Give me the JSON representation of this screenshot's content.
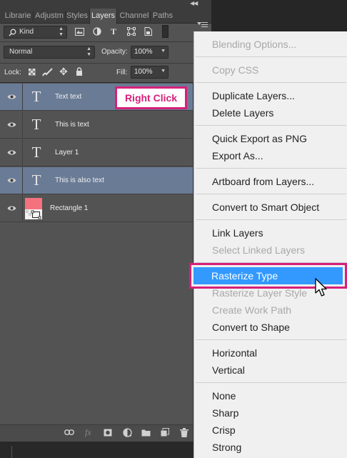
{
  "tabs": [
    {
      "label": "Librarie",
      "active": false
    },
    {
      "label": "Adjustm",
      "active": false
    },
    {
      "label": "Styles",
      "active": false
    },
    {
      "label": "Layers",
      "active": true
    },
    {
      "label": "Channel",
      "active": false
    },
    {
      "label": "Paths",
      "active": false
    }
  ],
  "filter": {
    "label": "Kind"
  },
  "blend": {
    "mode": "Normal",
    "opacity_label": "Opacity:",
    "opacity": "100%"
  },
  "lock": {
    "label": "Lock:",
    "fill_label": "Fill:",
    "fill": "100%"
  },
  "layers": [
    {
      "name": "Text text",
      "kind": "text",
      "selected": true,
      "visible": true
    },
    {
      "name": "This is text",
      "kind": "text",
      "selected": false,
      "visible": true
    },
    {
      "name": "Layer 1",
      "kind": "text",
      "selected": false,
      "visible": true
    },
    {
      "name": "This is also text",
      "kind": "text",
      "selected": true,
      "visible": true
    },
    {
      "name": "Rectangle 1",
      "kind": "shape",
      "selected": false,
      "visible": true
    }
  ],
  "callout": "Right Click",
  "menu": {
    "items": [
      {
        "label": "Blending Options...",
        "disabled": true
      },
      {
        "label": "Copy CSS",
        "disabled": true
      },
      {
        "label": "Duplicate Layers...",
        "disabled": false
      },
      {
        "label": "Delete Layers",
        "disabled": false
      },
      {
        "label": "Quick Export as PNG",
        "disabled": false
      },
      {
        "label": "Export As...",
        "disabled": false
      },
      {
        "label": "Artboard from Layers...",
        "disabled": false
      },
      {
        "label": "Convert to Smart Object",
        "disabled": false
      },
      {
        "label": "Link Layers",
        "disabled": false
      },
      {
        "label": "Select Linked Layers",
        "disabled": true
      },
      {
        "label": "Rasterize Type",
        "disabled": false,
        "highlighted": true
      },
      {
        "label": "Rasterize Layer Style",
        "disabled": true
      },
      {
        "label": "Create Work Path",
        "disabled": true
      },
      {
        "label": "Convert to Shape",
        "disabled": false
      },
      {
        "label": "Horizontal",
        "disabled": false
      },
      {
        "label": "Vertical",
        "disabled": false
      },
      {
        "label": "None",
        "disabled": false
      },
      {
        "label": "Sharp",
        "disabled": false
      },
      {
        "label": "Crisp",
        "disabled": false
      },
      {
        "label": "Strong",
        "disabled": false
      }
    ]
  },
  "colors": {
    "accent": "#d6207a",
    "selected_layer": "#6a7b96",
    "menu_highlight": "#3399ff",
    "panel_bg": "#535353"
  },
  "icons": [
    "search-icon",
    "image-filter-icon",
    "adjustment-filter-icon",
    "type-filter-icon",
    "shape-filter-icon",
    "smart-object-filter-icon",
    "filter-toggle-icon",
    "lock-transparent-icon",
    "lock-image-icon",
    "lock-position-icon",
    "lock-all-icon",
    "eye-icon",
    "link-icon",
    "fx-icon",
    "mask-icon",
    "adjustment-icon",
    "folder-icon",
    "new-layer-icon",
    "trash-icon",
    "cursor-icon"
  ]
}
